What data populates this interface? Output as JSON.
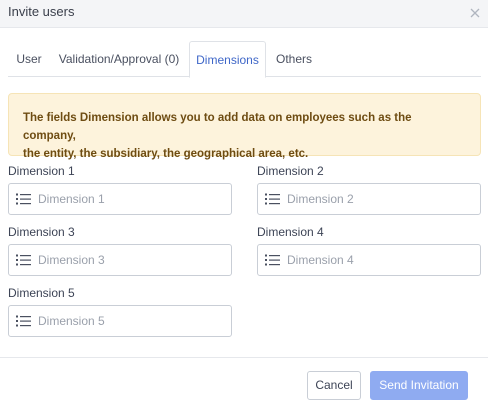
{
  "dialog": {
    "title": "Invite users",
    "close_icon": "close-icon"
  },
  "tabs": [
    {
      "label": "User",
      "active": false
    },
    {
      "label": "Validation/Approval (0)",
      "active": false
    },
    {
      "label": "Dimensions",
      "active": true
    },
    {
      "label": "Others",
      "active": false
    }
  ],
  "info": {
    "line1": "The fields Dimension allows you to add data on employees such as the company,",
    "line2": "the entity, the subsidiary, the geographical area, etc."
  },
  "dimensions": [
    {
      "label": "Dimension 1",
      "placeholder": "Dimension 1",
      "value": "",
      "icon": "list-icon"
    },
    {
      "label": "Dimension 2",
      "placeholder": "Dimension 2",
      "value": "",
      "icon": "list-icon"
    },
    {
      "label": "Dimension 3",
      "placeholder": "Dimension 3",
      "value": "",
      "icon": "list-icon"
    },
    {
      "label": "Dimension 4",
      "placeholder": "Dimension 4",
      "value": "",
      "icon": "list-icon"
    },
    {
      "label": "Dimension 5",
      "placeholder": "Dimension 5",
      "value": "",
      "icon": "list-icon"
    }
  ],
  "footer": {
    "cancel_label": "Cancel",
    "send_label": "Send Invitation"
  },
  "colors": {
    "accent": "#3f67c8",
    "primary_button": "#8fabf1",
    "info_background": "#fdf3dc",
    "info_text": "#6e4c12"
  }
}
